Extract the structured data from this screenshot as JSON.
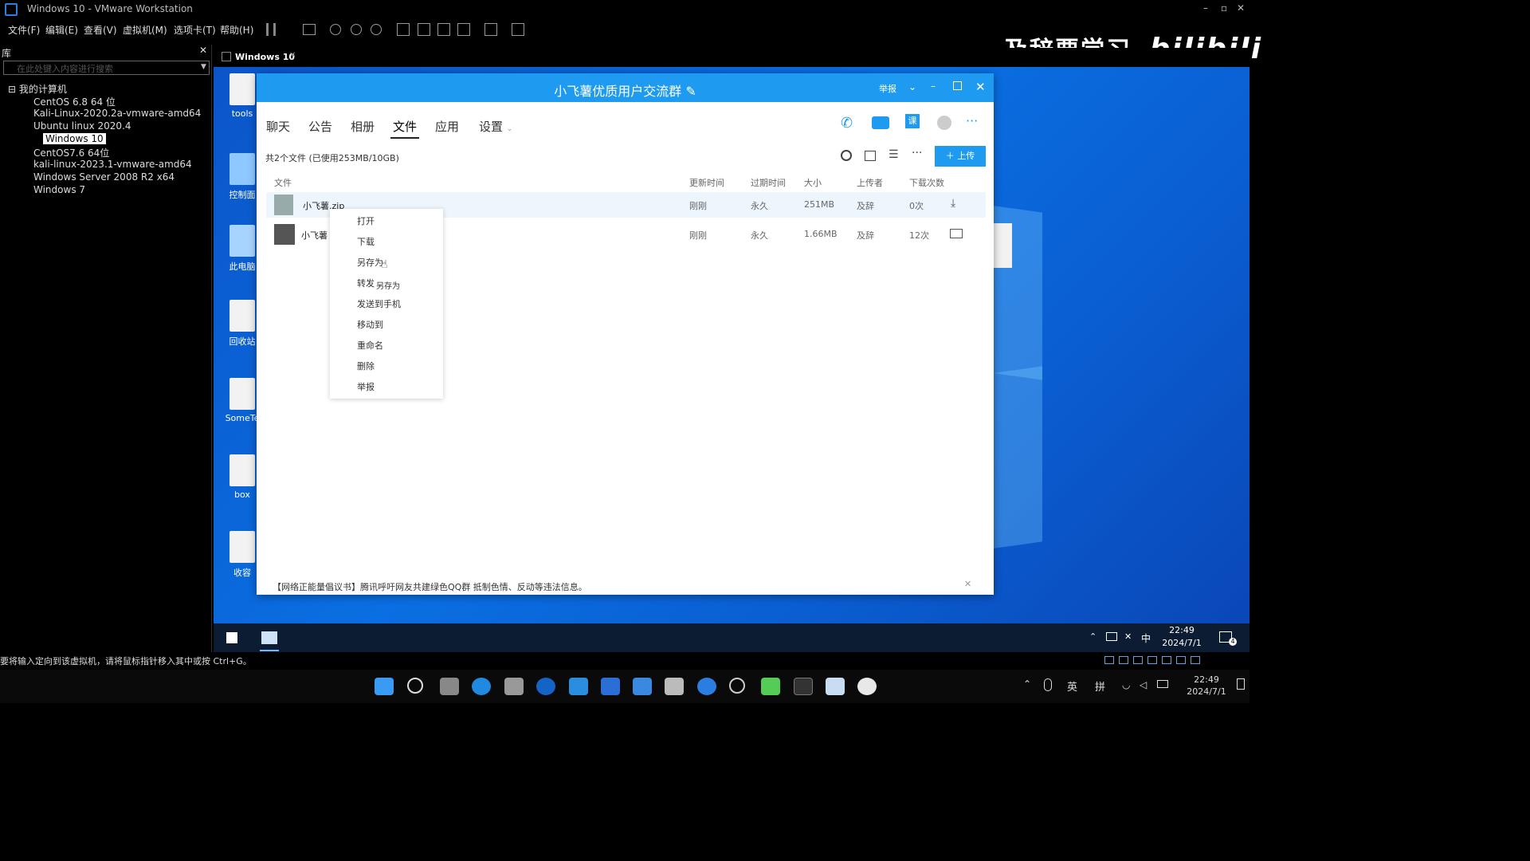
{
  "host": {
    "title": "Windows 10 - VMware Workstation",
    "menu": [
      "文件(F)",
      "编辑(E)",
      "查看(V)",
      "虚拟机(M)",
      "选项卡(T)",
      "帮助(H)"
    ],
    "watermark": "及辞要学习",
    "brand": "bilibili"
  },
  "library": {
    "title": "库",
    "search_placeholder": "在此处键入内容进行搜索",
    "root": "我的计算机",
    "items": [
      "CentOS 6.8 64 位",
      "Kali-Linux-2020.2a-vmware-amd64",
      "Ubuntu linux 2020.4",
      "Windows 10",
      "CentOS7.6 64位",
      "kali-linux-2023.1-vmware-amd64",
      "Windows Server 2008 R2 x64",
      "Windows 7"
    ],
    "selected_index": 3
  },
  "vm_tab": {
    "label": "Windows 10"
  },
  "desktop_icons": [
    "tools",
    "控制面",
    "此电脑",
    "回收站",
    "SomeTe",
    "box",
    "收容"
  ],
  "qq": {
    "title": "小飞薯优质用户交流群",
    "report": "举报",
    "tabs": [
      "聊天",
      "公告",
      "相册",
      "文件",
      "应用",
      "设置"
    ],
    "active_tab": "文件",
    "summary": "共2个文件 (已使用253MB/10GB)",
    "upload_label": "上传",
    "call_label": "课",
    "columns": [
      "文件",
      "更新时间",
      "过期时间",
      "大小",
      "上传者",
      "下载次数"
    ],
    "files": [
      {
        "name": "小飞薯.zip",
        "updated": "刚刚",
        "expires": "永久",
        "size": "251MB",
        "uploader": "及辞",
        "downloads": "0次"
      },
      {
        "name": "小飞薯",
        "updated": "刚刚",
        "expires": "永久",
        "size": "1.66MB",
        "uploader": "及辞",
        "downloads": "12次"
      }
    ],
    "context_menu": [
      "打开",
      "下载",
      "另存为",
      "转发",
      "发送到手机",
      "移动到",
      "重命名",
      "删除",
      "举报"
    ],
    "tooltip": "另存为",
    "notice": "【网络正能量倡议书】腾讯呼吁网友共建绿色QQ群 抵制色情、反动等违法信息。"
  },
  "guest_taskbar": {
    "ime": "中",
    "time": "22:49",
    "date": "2024/7/1",
    "notif_count": "4"
  },
  "statusbar": {
    "hint": "要将输入定向到该虚拟机，请将鼠标指针移入其中或按 Ctrl+G。"
  },
  "host_taskbar": {
    "lang": "英",
    "ime": "拼",
    "time": "22:49",
    "date": "2024/7/1"
  },
  "colors": {
    "qq_blue": "#1e9bf0",
    "desktop_blue": "#0a6fe2"
  }
}
